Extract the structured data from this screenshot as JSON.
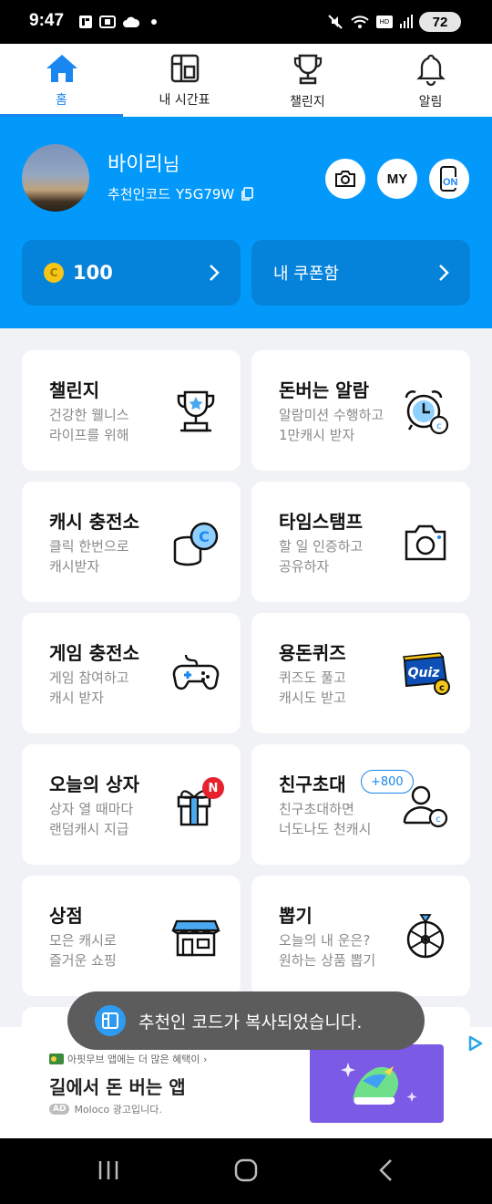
{
  "status_bar": {
    "time": "9:47",
    "battery": "72"
  },
  "tabs": [
    {
      "label": "홈",
      "icon": "home-icon",
      "active": true
    },
    {
      "label": "내 시간표",
      "icon": "timetable-icon",
      "active": false
    },
    {
      "label": "챌린지",
      "icon": "trophy-icon",
      "active": false
    },
    {
      "label": "알림",
      "icon": "bell-icon",
      "active": false
    }
  ],
  "profile": {
    "name": "바이리",
    "name_suffix": "님",
    "referral_label": "추천인코드",
    "referral_code": "Y5G79W",
    "my_button": "MY",
    "on_button": "ON",
    "coin_amount": "100",
    "coupon_label": "내 쿠폰함"
  },
  "cards": [
    {
      "title": "챌린지",
      "line1": "건강한 웰니스",
      "line2": "라이프를 위해",
      "icon": "trophy-icon"
    },
    {
      "title": "돈버는 알람",
      "line1": "알람미션 수행하고",
      "line2": "1만캐시 받자",
      "icon": "alarm-clock-icon"
    },
    {
      "title": "캐시 충전소",
      "line1": "클릭 한번으로",
      "line2": "캐시받자",
      "icon": "coin-stack-icon"
    },
    {
      "title": "타임스탬프",
      "line1": "할 일 인증하고",
      "line2": "공유하자",
      "icon": "camera-icon"
    },
    {
      "title": "게임 충전소",
      "line1": "게임 참여하고",
      "line2": "캐시 받자",
      "icon": "gamepad-icon"
    },
    {
      "title": "용돈퀴즈",
      "line1": "퀴즈도 풀고",
      "line2": "캐시도 받고",
      "icon": "quiz-icon",
      "icon_text": "Quiz"
    },
    {
      "title": "오늘의 상자",
      "line1": "상자 열 때마다",
      "line2": "랜덤캐시 지급",
      "icon": "gift-box-icon",
      "badge": "N"
    },
    {
      "title": "친구초대",
      "line1": "친구초대하면",
      "line2": "너도나도 천캐시",
      "icon": "user-coin-icon",
      "pill": "+800"
    },
    {
      "title": "상점",
      "line1": "모은 캐시로",
      "line2": "즐거운 쇼핑",
      "icon": "store-icon"
    },
    {
      "title": "뽑기",
      "line1": "오늘의 내 운은?",
      "line2": "원하는 상품 뽑기",
      "icon": "roulette-icon"
    }
  ],
  "toast": {
    "text": "추천인 코드가 복사되었습니다."
  },
  "ad": {
    "small_text": "아핏무브 앱에는 더 많은 혜택이 ›",
    "headline": "길에서 돈 버는 앱",
    "tag": "AD",
    "advertiser": "Moloco 광고입니다."
  },
  "colors": {
    "primary": "#0399fb",
    "accent": "#1a86f0",
    "card_dark": "#0583db",
    "badge": "#e8222d"
  }
}
